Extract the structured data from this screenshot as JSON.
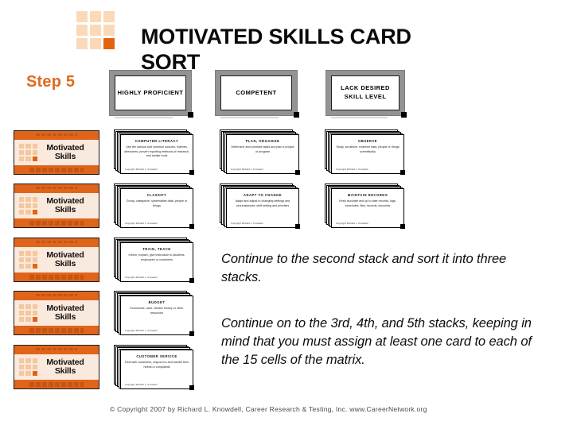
{
  "slide": {
    "title": "MOTIVATED SKILLS CARD SORT",
    "step_label": "Step 5",
    "accent_color": "#dd6b1d",
    "card_orange": "#e0651a",
    "header_gray": "#939393"
  },
  "logo": {
    "name": "motivated-skills-logo",
    "cells": [
      {
        "accent": false
      },
      {
        "accent": false
      },
      {
        "accent": false
      },
      {
        "accent": false
      },
      {
        "accent": false
      },
      {
        "accent": false
      },
      {
        "accent": false
      },
      {
        "accent": false
      },
      {
        "accent": true
      }
    ]
  },
  "column_headers": [
    {
      "id": "highly-proficient",
      "label": "HIGHLY PROFICIENT"
    },
    {
      "id": "competent",
      "label": "COMPETENT"
    },
    {
      "id": "lack-desired-skill-level",
      "label": "LACK DESIRED SKILL LEVEL"
    }
  ],
  "motivated_skills_cards": [
    {
      "title": "Motivated Skills"
    },
    {
      "title": "Motivated Skills"
    },
    {
      "title": "Motivated Skills"
    },
    {
      "title": "Motivated Skills"
    },
    {
      "title": "Motivated Skills"
    }
  ],
  "card_stacks": [
    {
      "row": 1,
      "column": "highly-proficient",
      "title": "COMPUTER LITERACY",
      "body": "Use the various and common sources, indexes, directories, proven reporting methods of research, and similar tools",
      "footer": "Copyright Richard L. Knowdell"
    },
    {
      "row": 1,
      "column": "competent",
      "title": "PLAN, ORGANIZE",
      "body": "Determine and prioritize tasks and plan a project or program",
      "footer": "Copyright Richard L. Knowdell"
    },
    {
      "row": 1,
      "column": "lack-desired-skill-level",
      "title": "OBSERVE",
      "body": "Study, scrutinize, examine data, people or things scientifically",
      "footer": "Copyright Richard L. Knowdell"
    },
    {
      "row": 2,
      "column": "highly-proficient",
      "title": "CLASSIFY",
      "body": "Group, categorize, systematize data, people or things",
      "footer": "Copyright Richard L. Knowdell"
    },
    {
      "row": 2,
      "column": "competent",
      "title": "ADAPT TO CHANGE",
      "body": "Adapt and adjust to changing settings and circumstances, shift setting and priorities",
      "footer": "Copyright Richard L. Knowdell"
    },
    {
      "row": 2,
      "column": "lack-desired-skill-level",
      "title": "MAINTAIN RECORDS",
      "body": "Keep accurate and up to date records, logs, schedules, files, records, accounts",
      "footer": "Copyright Richard L. Knowdell"
    },
    {
      "row": 3,
      "column": "highly-proficient",
      "title": "TRAIN, TEACH",
      "body": "Inform, explain, give instruction to students, employees or customers",
      "footer": "Copyright Richard L. Knowdell"
    },
    {
      "row": 4,
      "column": "highly-proficient",
      "title": "BUDGET",
      "body": "Economize, save, stretch money or other resources",
      "footer": "Copyright Richard L. Knowdell"
    },
    {
      "row": 5,
      "column": "highly-proficient",
      "title": "CUSTOMER SERVICE",
      "body": "Deal with customers, respond to and handle their needs or complaints",
      "footer": "Copyright Richard L. Knowdell"
    }
  ],
  "paragraphs": {
    "para1": "Continue to the second stack and sort it into three stacks.",
    "para2": "Continue on to the 3rd, 4th, and 5th stacks, keeping in mind that you must assign at least one card to each of the 15 cells of the matrix."
  },
  "copyright": "© Copyright 2007 by Richard L. Knowdell, Career Research & Testing, Inc. www.CareerNetwork.org"
}
